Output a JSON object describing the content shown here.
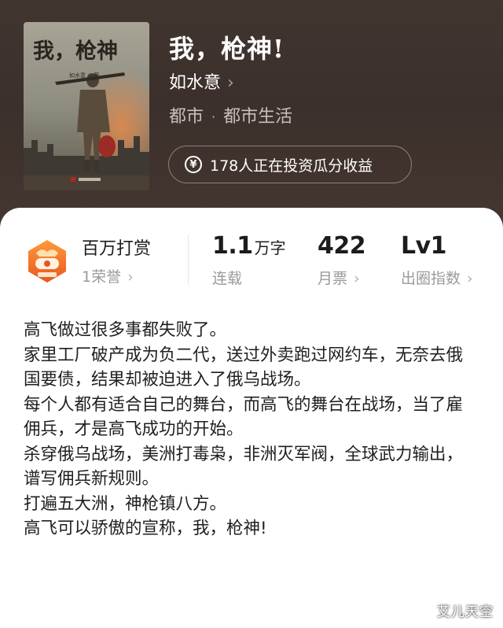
{
  "book": {
    "title": "我，枪神!",
    "author": "如水意",
    "genre_primary": "都市",
    "genre_separator": "·",
    "genre_secondary": "都市生活",
    "invest_text": "178人正在投资瓜分收益",
    "cover_title": "我，枪神",
    "cover_author": "如水意 ◎ 著"
  },
  "icons": {
    "author_chevron": "chevron-right-icon",
    "invest": "yen-circle-icon",
    "reward": "reward-badge-icon"
  },
  "stats": {
    "reward": {
      "label": "百万打赏",
      "sub": "1荣誉"
    },
    "words": {
      "value": "1.1",
      "unit": "万字",
      "label": "连载"
    },
    "tickets": {
      "value": "422",
      "label": "月票"
    },
    "influence": {
      "value": "Lv1",
      "label": "出圈指数"
    }
  },
  "description": [
    "高飞做过很多事都失败了。",
    "家里工厂破产成为负二代，送过外卖跑过网约车，无奈去俄国要债，结果却被迫进入了俄乌战场。",
    "每个人都有适合自己的舞台，而高飞的舞台在战场，当了雇佣兵，才是高飞成功的开始。",
    "杀穿俄乌战场，美洲打毒枭，非洲灭军阀，全球武力输出，谱写佣兵新规则。",
    "打遍五大洲，神枪镇八方。",
    "高飞可以骄傲的宣称，我，枪神!"
  ],
  "watermark": "艾儿天空",
  "colors": {
    "header_bg": "#3b302b",
    "card_bg": "#ffffff",
    "text_primary": "#1c1c1c",
    "text_muted": "#9a9a9a",
    "reward_orange": "#f07a2a"
  }
}
